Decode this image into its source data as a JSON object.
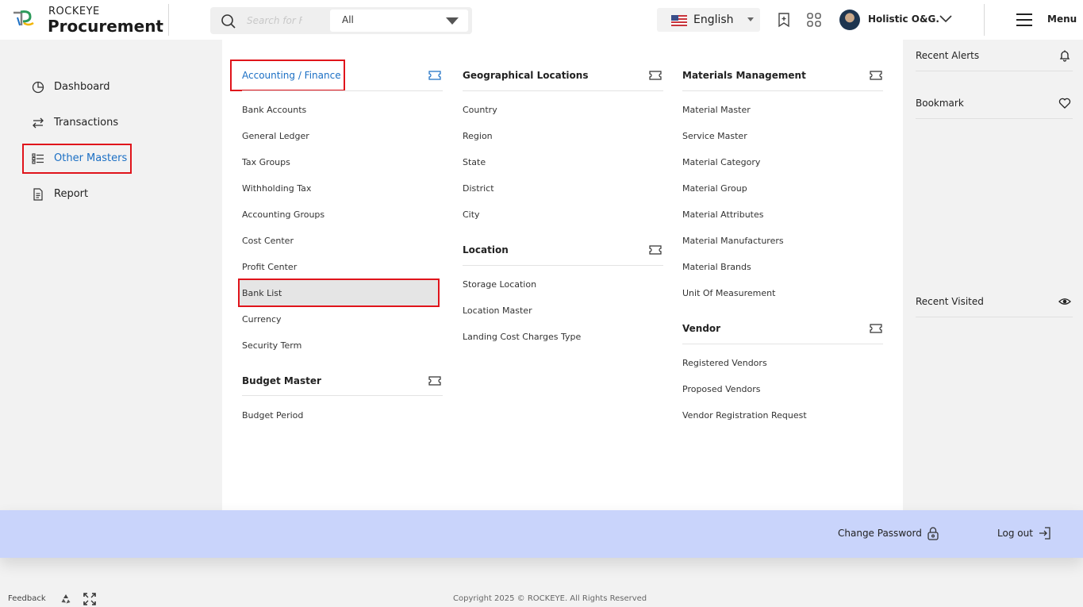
{
  "header": {
    "brand_top": "ROCKEYE",
    "brand_main": "Procurement",
    "search_placeholder": "Search for F",
    "scope_value": "All",
    "language": "English",
    "user_name": "Holistic O&G.",
    "menu_label": "Menu"
  },
  "sidebar": {
    "items": [
      {
        "label": "Dashboard",
        "icon": "dashboard-pie-icon"
      },
      {
        "label": "Transactions",
        "icon": "transactions-arrows-icon"
      },
      {
        "label": "Other Masters",
        "icon": "list-icon",
        "active": true
      },
      {
        "label": "Report",
        "icon": "report-document-icon"
      }
    ]
  },
  "mega_menu": {
    "accounting": {
      "title": "Accounting / Finance",
      "links": [
        "Bank Accounts",
        "General Ledger",
        "Tax Groups",
        "Withholding Tax",
        "Accounting Groups",
        "Cost Center",
        "Profit Center",
        "Bank List",
        "Currency",
        "Security Term"
      ]
    },
    "budget": {
      "title": "Budget Master",
      "links": [
        "Budget Period"
      ]
    },
    "geo": {
      "title": "Geographical Locations",
      "links": [
        "Country",
        "Region",
        "State",
        "District",
        "City"
      ]
    },
    "location": {
      "title": "Location",
      "links": [
        "Storage Location",
        "Location Master",
        "Landing Cost Charges Type"
      ]
    },
    "materials": {
      "title": "Materials Management",
      "links": [
        "Material Master",
        "Service Master",
        "Material Category",
        "Material Group",
        "Material Attributes",
        "Material Manufacturers",
        "Material Brands",
        "Unit Of Measurement"
      ]
    },
    "vendor": {
      "title": "Vendor",
      "links": [
        "Registered Vendors",
        "Proposed Vendors",
        "Vendor Registration Request"
      ]
    }
  },
  "right_panel": {
    "recent_alerts": "Recent Alerts",
    "bookmark": "Bookmark",
    "recent_visited": "Recent Visited"
  },
  "footer": {
    "change_password": "Change Password",
    "logout": "Log out",
    "feedback": "Feedback",
    "copyright": "Copyright 2025 © ROCKEYE. All Rights Reserved"
  },
  "colors": {
    "accent_blue": "#1b6fc4",
    "highlight_red": "#e0141b",
    "footer_bar": "#c9d4fb"
  }
}
